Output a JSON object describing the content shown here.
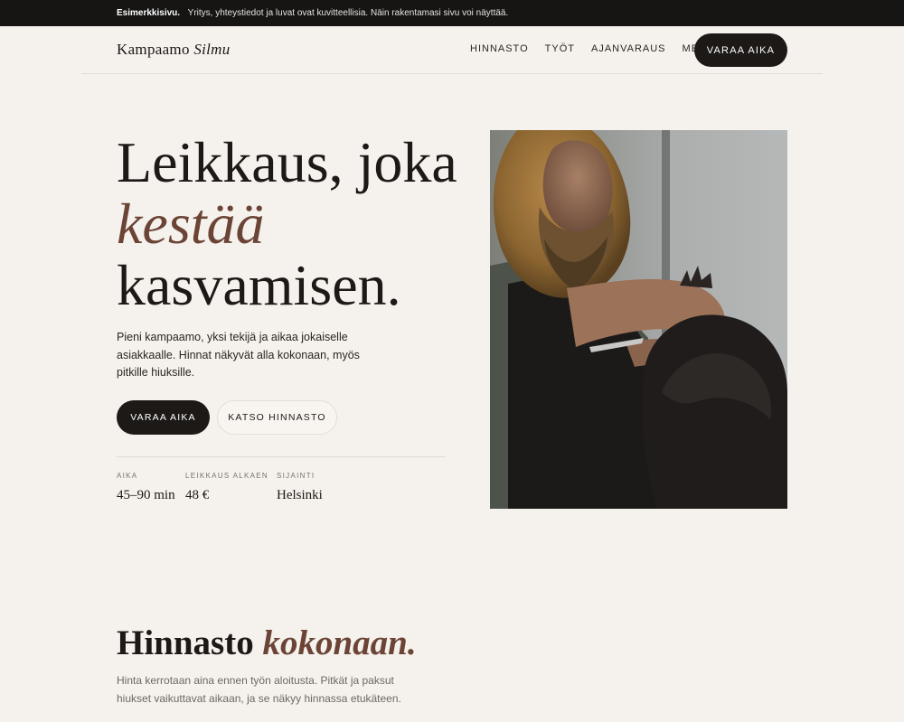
{
  "notice": {
    "label": "Esimerkkisivu.",
    "text": "Yritys, yhteystiedot ja luvat ovat kuvitteellisia. Näin rakentamasi sivu voi näyttää."
  },
  "header": {
    "brand_name": "Kampaamo",
    "brand_accent": "Silmu",
    "nav": [
      "HINNASTO",
      "TYÖT",
      "AJANVARAUS",
      "MEISTÄ"
    ],
    "cta": "VARAA AIKA"
  },
  "hero": {
    "title_line1": "Leikkaus, joka",
    "title_accent": "kestää",
    "title_line3": "kasvamisen.",
    "lede": "Pieni kampaamo, yksi tekijä ja aikaa jokaiselle asiakkaalle. Hinnat näkyvät alla kokonaan, myös pitkille hiuksille.",
    "primary_button": "VARAA AIKA",
    "secondary_button": "KATSO HINNASTO",
    "stats": [
      {
        "label": "AIKA",
        "value": "45–90 min"
      },
      {
        "label": "LEIKKAUS ALKAEN",
        "value": "48 €"
      },
      {
        "label": "SIJAINTI",
        "value": "Helsinki"
      }
    ]
  },
  "pricing": {
    "title": "Hinnasto",
    "title_accent": "kokonaan.",
    "lede": "Hinta kerrotaan aina ennen työn aloitusta. Pitkät ja paksut hiukset vaikuttavat aikaan, ja se näkyy hinnassa etukäteen."
  },
  "colors": {
    "background": "#f5f1ec",
    "ink": "#1c1917",
    "accent": "#6b4436",
    "notice_bar": "#161514"
  }
}
